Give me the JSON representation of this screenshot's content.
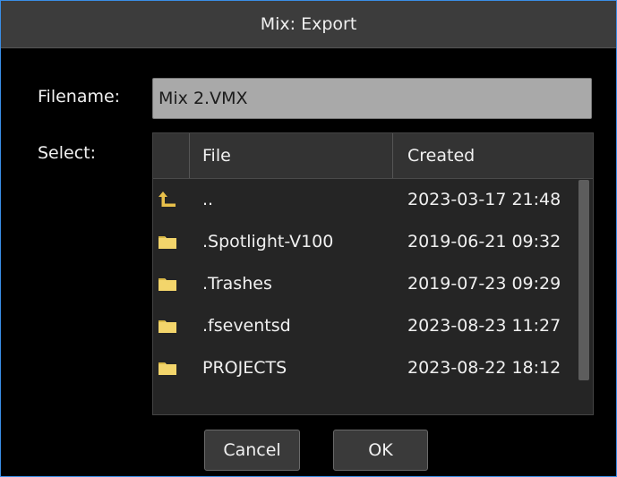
{
  "dialog": {
    "title": "Mix: Export"
  },
  "form": {
    "filename_label": "Filename:",
    "filename_value": "Mix 2.VMX",
    "select_label": "Select:"
  },
  "table": {
    "columns": [
      "File",
      "Created"
    ],
    "rows": [
      {
        "icon": "parent-folder-icon",
        "name": "..",
        "created": "2023-03-17 21:48"
      },
      {
        "icon": "folder-icon",
        "name": ".Spotlight-V100",
        "created": "2019-06-21 09:32"
      },
      {
        "icon": "folder-icon",
        "name": ".Trashes",
        "created": "2019-07-23 09:29"
      },
      {
        "icon": "folder-icon",
        "name": ".fseventsd",
        "created": "2023-08-23 11:27"
      },
      {
        "icon": "folder-icon",
        "name": "PROJECTS",
        "created": "2023-08-22 18:12"
      }
    ]
  },
  "buttons": {
    "cancel": "Cancel",
    "ok": "OK"
  },
  "colors": {
    "accent_border": "#3a8ee6",
    "folder": "#f3d56b",
    "parent_arrow": "#e8c04a"
  }
}
